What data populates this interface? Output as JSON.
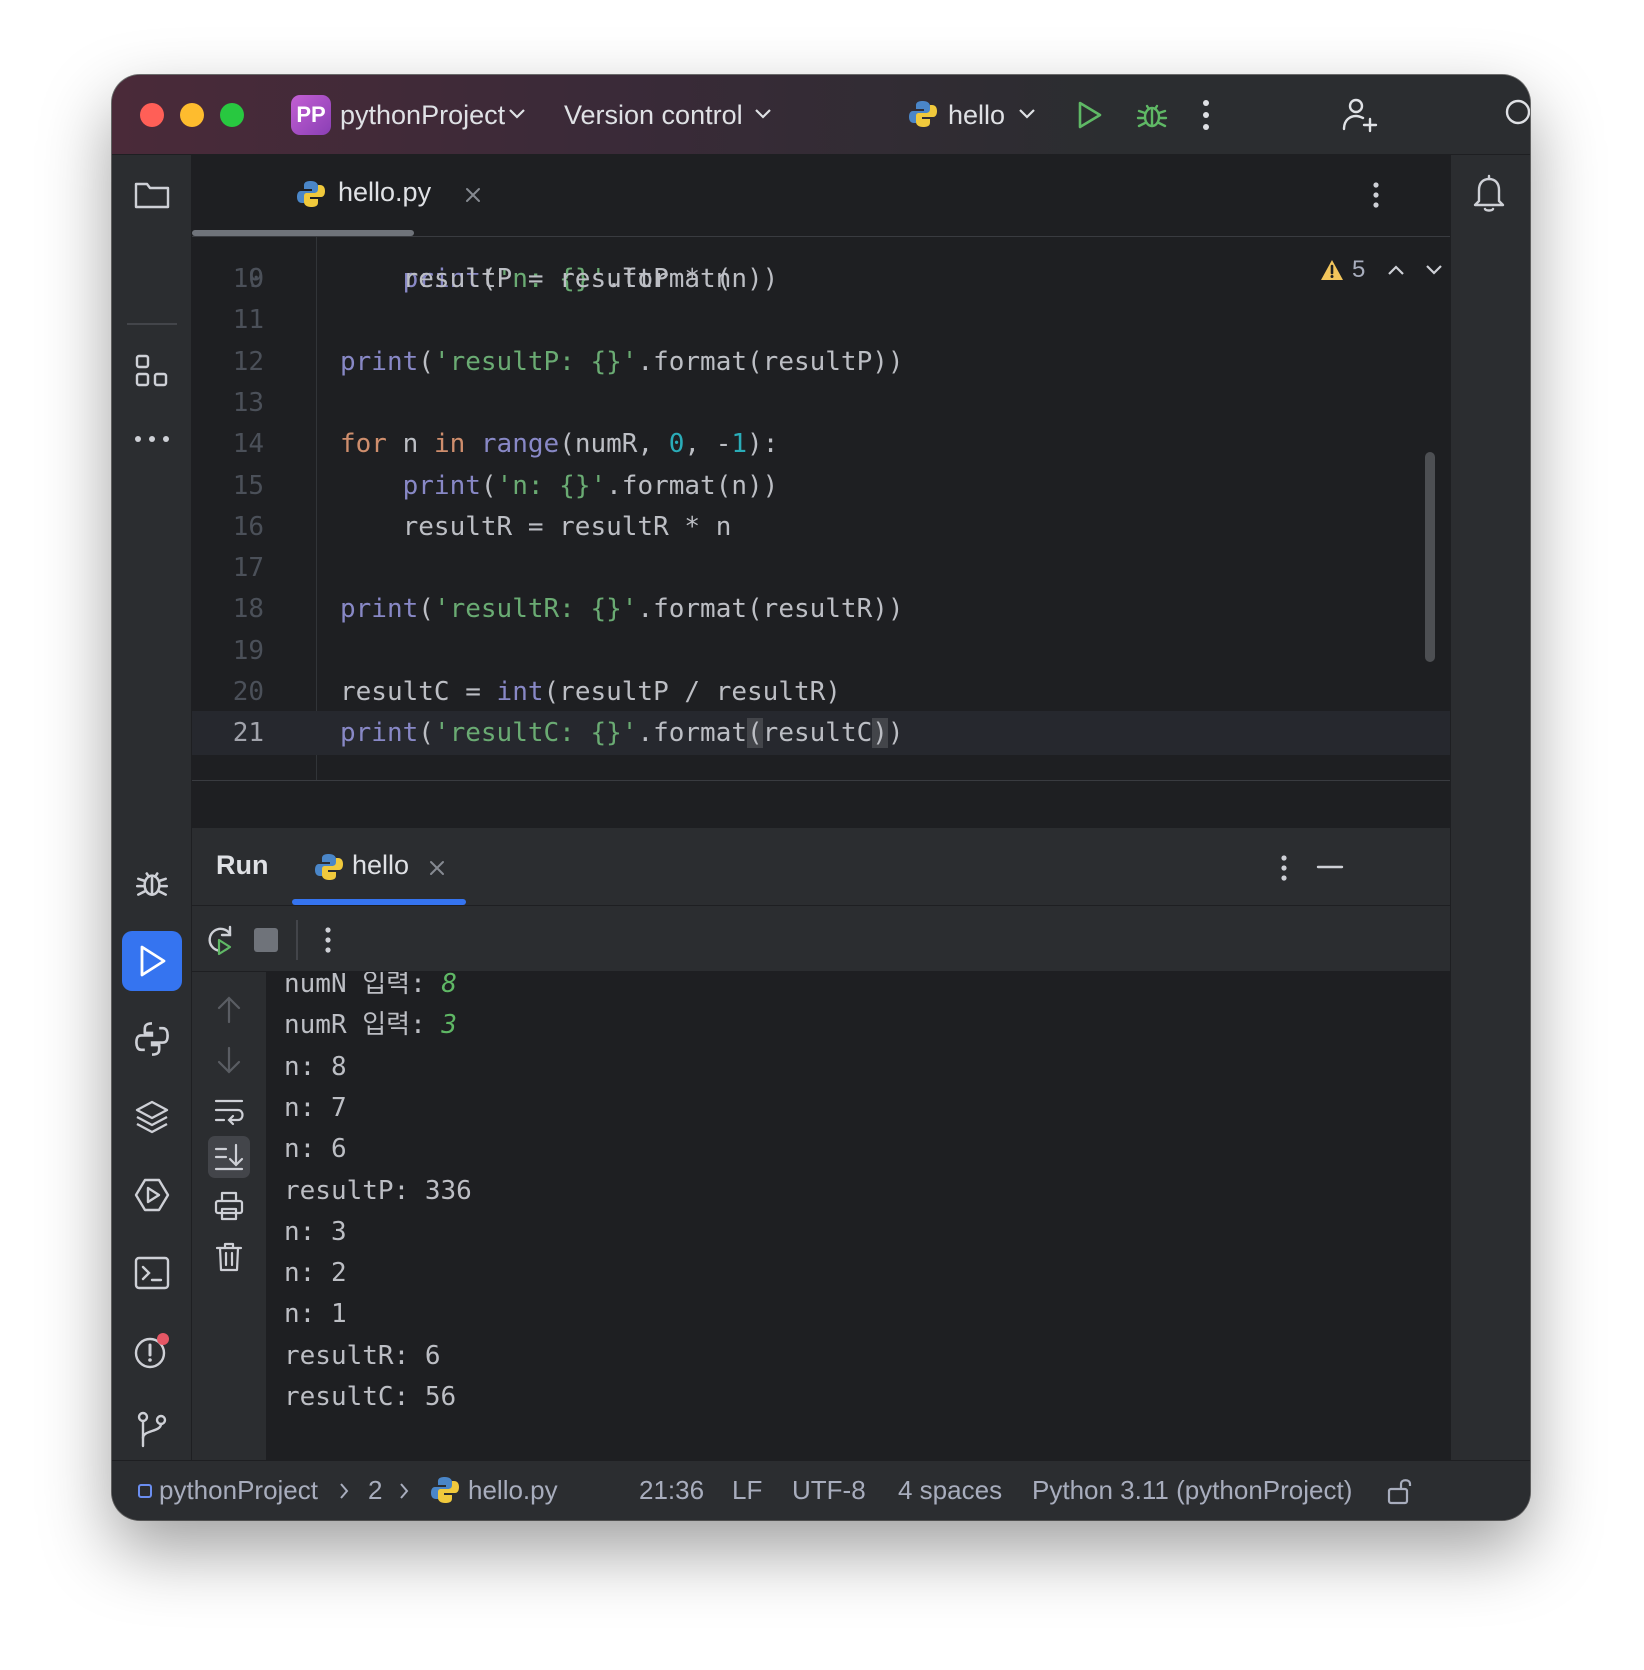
{
  "titlebar": {
    "project_badge": "PP",
    "project_name": "pythonProject",
    "vcs_label": "Version control",
    "run_config": "hello"
  },
  "editor_tab": {
    "filename": "hello.py"
  },
  "inspections": {
    "warning_count": "5"
  },
  "code_lines": [
    {
      "num": "10",
      "indent": "    ",
      "tokens": [
        [
          "t",
          "resultP = resultP * n"
        ]
      ]
    },
    {
      "num": "11",
      "indent": "",
      "tokens": []
    },
    {
      "num": "12",
      "indent": "",
      "tokens": [
        [
          "bi",
          "print"
        ],
        [
          "t",
          "("
        ],
        [
          "st",
          "'resultP: {}'"
        ],
        [
          "t",
          ".format(resultP))"
        ]
      ]
    },
    {
      "num": "13",
      "indent": "",
      "tokens": []
    },
    {
      "num": "14",
      "indent": "",
      "tokens": [
        [
          "kw",
          "for"
        ],
        [
          "t",
          " n "
        ],
        [
          "kw",
          "in"
        ],
        [
          "t",
          " "
        ],
        [
          "bi",
          "range"
        ],
        [
          "t",
          "(numR, "
        ],
        [
          "nm",
          "0"
        ],
        [
          "t",
          ", -"
        ],
        [
          "nm",
          "1"
        ],
        [
          "t",
          "):"
        ]
      ]
    },
    {
      "num": "15",
      "indent": "    ",
      "tokens": [
        [
          "bi",
          "print"
        ],
        [
          "t",
          "("
        ],
        [
          "st",
          "'n: {}'"
        ],
        [
          "t",
          ".format(n))"
        ]
      ]
    },
    {
      "num": "16",
      "indent": "    ",
      "tokens": [
        [
          "t",
          "resultR = resultR * n"
        ]
      ]
    },
    {
      "num": "17",
      "indent": "",
      "tokens": []
    },
    {
      "num": "18",
      "indent": "",
      "tokens": [
        [
          "bi",
          "print"
        ],
        [
          "t",
          "("
        ],
        [
          "st",
          "'resultR: {}'"
        ],
        [
          "t",
          ".format(resultR))"
        ]
      ]
    },
    {
      "num": "19",
      "indent": "",
      "tokens": []
    },
    {
      "num": "20",
      "indent": "",
      "tokens": [
        [
          "t",
          "resultC = "
        ],
        [
          "bi",
          "int"
        ],
        [
          "t",
          "(resultP / resultR)"
        ]
      ]
    },
    {
      "num": "21",
      "indent": "",
      "tokens": [
        [
          "bi",
          "print"
        ],
        [
          "t",
          "("
        ],
        [
          "st",
          "'resultC: {}'"
        ],
        [
          "t",
          ".format"
        ],
        [
          "br",
          "("
        ],
        [
          "t",
          "resultC"
        ],
        [
          "br",
          ")"
        ],
        [
          "t",
          ")"
        ]
      ]
    }
  ],
  "run_panel": {
    "title": "Run",
    "tab_label": "hello"
  },
  "console_lines": [
    {
      "text": "numN 입력: ",
      "input": "8"
    },
    {
      "text": "numR 입력: ",
      "input": "3"
    },
    {
      "text": "n: 8"
    },
    {
      "text": "n: 7"
    },
    {
      "text": "n: 6"
    },
    {
      "text": "resultP: 336"
    },
    {
      "text": "n: 3"
    },
    {
      "text": "n: 2"
    },
    {
      "text": "n: 1"
    },
    {
      "text": "resultR: 6"
    },
    {
      "text": "resultC: 56"
    }
  ],
  "statusbar": {
    "project": "pythonProject",
    "folder": "2",
    "file": "hello.py",
    "caret": "21:36",
    "line_sep": "LF",
    "encoding": "UTF-8",
    "indent": "4 spaces",
    "interpreter": "Python 3.11 (pythonProject)"
  },
  "icons": {
    "window_close": "red-circle",
    "window_minimize": "yellow-circle",
    "window_zoom": "green-circle",
    "run": "play-icon",
    "debug": "bug-icon",
    "more": "kebab-icon",
    "collab": "add-user-icon",
    "search": "search-icon",
    "notifications": "bell-icon",
    "python": "python-icon"
  },
  "colors": {
    "accent": "#3574f0",
    "run_green": "#5fb865",
    "keyword": "#cf8e6d",
    "builtin": "#8888c6",
    "string": "#6aab73",
    "number": "#2aacb8",
    "warning": "#f2c55c"
  }
}
